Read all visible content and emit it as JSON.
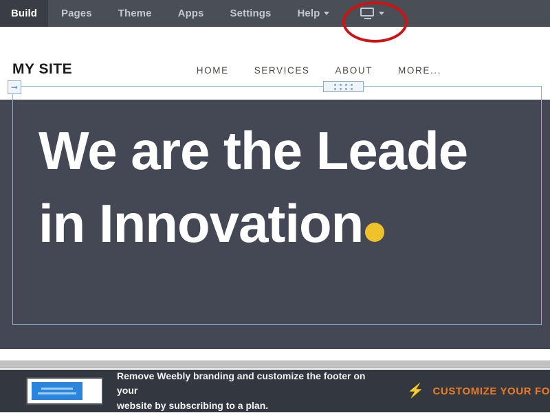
{
  "editor_toolbar": {
    "items": [
      {
        "label": "Build",
        "active": true,
        "caret": false
      },
      {
        "label": "Pages",
        "active": false,
        "caret": false
      },
      {
        "label": "Theme",
        "active": false,
        "caret": false
      },
      {
        "label": "Apps",
        "active": false,
        "caret": false
      },
      {
        "label": "Settings",
        "active": false,
        "caret": false
      },
      {
        "label": "Help",
        "active": false,
        "caret": true
      }
    ],
    "device_selector": {
      "icon": "monitor-icon",
      "caret": "chevron-down-icon"
    }
  },
  "annotation": {
    "shape": "ellipse",
    "color": "#cc1414",
    "target": "device-selector"
  },
  "site": {
    "logo": "MY SITE",
    "nav": [
      {
        "label": "HOME"
      },
      {
        "label": "SERVICES"
      },
      {
        "label": "ABOUT"
      },
      {
        "label": "MORE..."
      }
    ],
    "hero": {
      "line1": "We are the Leade",
      "line2": "in Innovation",
      "background_color": "#434854",
      "accent_dot_color": "#efc22c"
    }
  },
  "selection": {
    "arrow_handle_icon": "arrow-right-icon",
    "drag_handle_icon": "grip-dots-icon",
    "border_color": "#8fb0c9"
  },
  "bottom_banner": {
    "thumbnail_icon": "footer-preview-icon",
    "message_line1": "Remove Weebly branding and customize the footer on your",
    "message_line2": "website by subscribing to a plan.",
    "cta_icon": "lightning-bolt-icon",
    "cta_label": "CUSTOMIZE YOUR FO",
    "cta_color": "#f07c22"
  }
}
